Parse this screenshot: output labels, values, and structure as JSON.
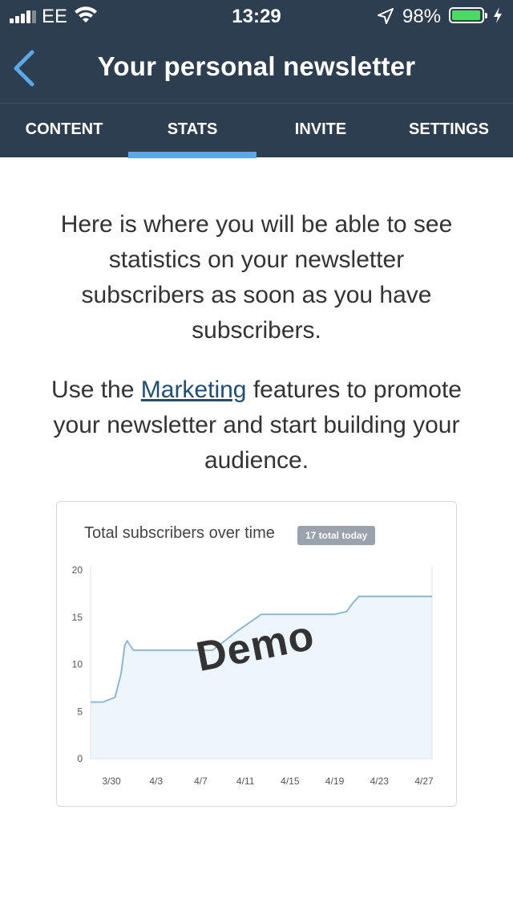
{
  "status": {
    "carrier": "EE",
    "time": "13:29",
    "battery_pct": "98%",
    "battery_level": 0.98,
    "battery_color": "#4cd964"
  },
  "nav": {
    "title": "Your personal newsletter",
    "back_icon": "chevron-left-icon"
  },
  "tabs": [
    {
      "label": "CONTENT",
      "active": false
    },
    {
      "label": "STATS",
      "active": true
    },
    {
      "label": "INVITE",
      "active": false
    },
    {
      "label": "SETTINGS",
      "active": false
    }
  ],
  "main": {
    "intro": "Here is where you will be able to see statistics on your newsletter subscribers as soon as you have subscribers.",
    "promo_before": "Use the ",
    "promo_link": "Marketing",
    "promo_after": " features to promote your newsletter and start building your audience."
  },
  "chart_card": {
    "title": "Total subscribers over time",
    "badge": "17 total today",
    "watermark": "Demo"
  },
  "colors": {
    "header_bg": "#2d3e50",
    "active_tab_underline": "#5aa9e6",
    "link": "#1f4e79",
    "line": "#8fb7d3",
    "area": "#eef6fd"
  },
  "chart_data": {
    "type": "area",
    "x_ticks": [
      "3/30",
      "4/3",
      "4/7",
      "4/11",
      "4/15",
      "4/19",
      "4/23",
      "4/27"
    ],
    "y_ticks": [
      0,
      5,
      10,
      15,
      20
    ],
    "ylim": [
      0,
      20
    ],
    "x": [
      0,
      1,
      2,
      2.5,
      2.8,
      3,
      3.5,
      4,
      6,
      8,
      9,
      10,
      11,
      12,
      14,
      16,
      18,
      20,
      21,
      21.5,
      22,
      24,
      26,
      28
    ],
    "y": [
      6,
      6,
      6.5,
      9,
      12,
      12.5,
      11.5,
      11.5,
      11.5,
      11.5,
      11.5,
      11.5,
      12.5,
      13.5,
      15.3,
      15.3,
      15.3,
      15.3,
      15.6,
      16.5,
      17.2,
      17.2,
      17.2,
      17.2
    ],
    "x_range": [
      0,
      28
    ],
    "grid": false
  }
}
